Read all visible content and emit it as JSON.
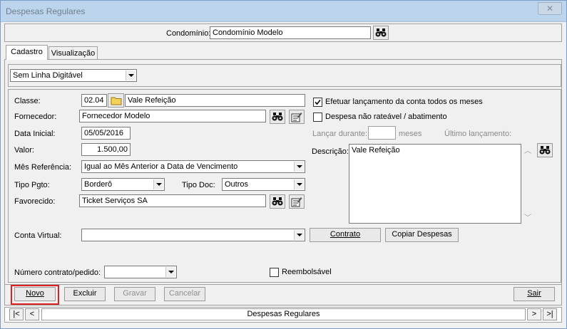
{
  "window": {
    "title": "Despesas Regulares",
    "close_glyph": "✕"
  },
  "condominio": {
    "label": "Condomínio:",
    "value": "Condomínio Modelo"
  },
  "tabs": [
    {
      "label": "Cadastro"
    },
    {
      "label": "Visualização"
    }
  ],
  "linha_digitavel": {
    "value": "Sem Linha Digitável"
  },
  "form": {
    "classe": {
      "label": "Classe:",
      "code": "02.04",
      "desc": "Vale Refeição"
    },
    "fornecedor": {
      "label": "Fornecedor:",
      "value": "Fornecedor Modelo"
    },
    "data_inicial": {
      "label": "Data Inicial:",
      "value": "05/05/2016"
    },
    "valor": {
      "label": "Valor:",
      "value": "1.500,00"
    },
    "mes_referencia": {
      "label": "Mês Referência:",
      "value": "Igual ao Mês Anterior a Data de Vencimento"
    },
    "tipo_pgto": {
      "label": "Tipo Pgto:",
      "value": "Borderô"
    },
    "tipo_doc": {
      "label": "Tipo Doc:",
      "value": "Outros"
    },
    "favorecido": {
      "label": "Favorecido:",
      "value": "Ticket Serviços SA"
    },
    "conta_virtual": {
      "label": "Conta Virtual:",
      "value": ""
    },
    "numero_contrato": {
      "label": "Número contrato/pedido:",
      "value": ""
    }
  },
  "right": {
    "efetuar": {
      "label": "Efetuar lançamento da conta todos os meses",
      "checked": true
    },
    "nao_rateavel": {
      "label": "Despesa não rateável / abatimento",
      "checked": false
    },
    "lancar_durante": {
      "label": "Lançar durante:",
      "suffix": "meses",
      "value": ""
    },
    "ultimo_lancamento": {
      "label": "Último lançamento:"
    },
    "descricao": {
      "label": "Descrição:",
      "value": "Vale Refeição"
    },
    "reembolsavel": {
      "label": "Reembolsável",
      "checked": false
    }
  },
  "buttons": {
    "contrato": "Contrato",
    "copiar": "Copiar Despesas",
    "novo": "Novo",
    "excluir": "Excluir",
    "gravar": "Gravar",
    "cancelar": "Cancelar",
    "sair": "Sair"
  },
  "navigator": {
    "first": "|<",
    "prev": "<",
    "label": "Despesas Regulares",
    "next": ">",
    "last": ">|"
  },
  "colors": {
    "highlight": "#e02020",
    "titlebar": "#bcd4ec"
  },
  "icons": {
    "search": "binoculars-icon",
    "folder": "folder-icon",
    "edit": "edit-record-icon"
  }
}
